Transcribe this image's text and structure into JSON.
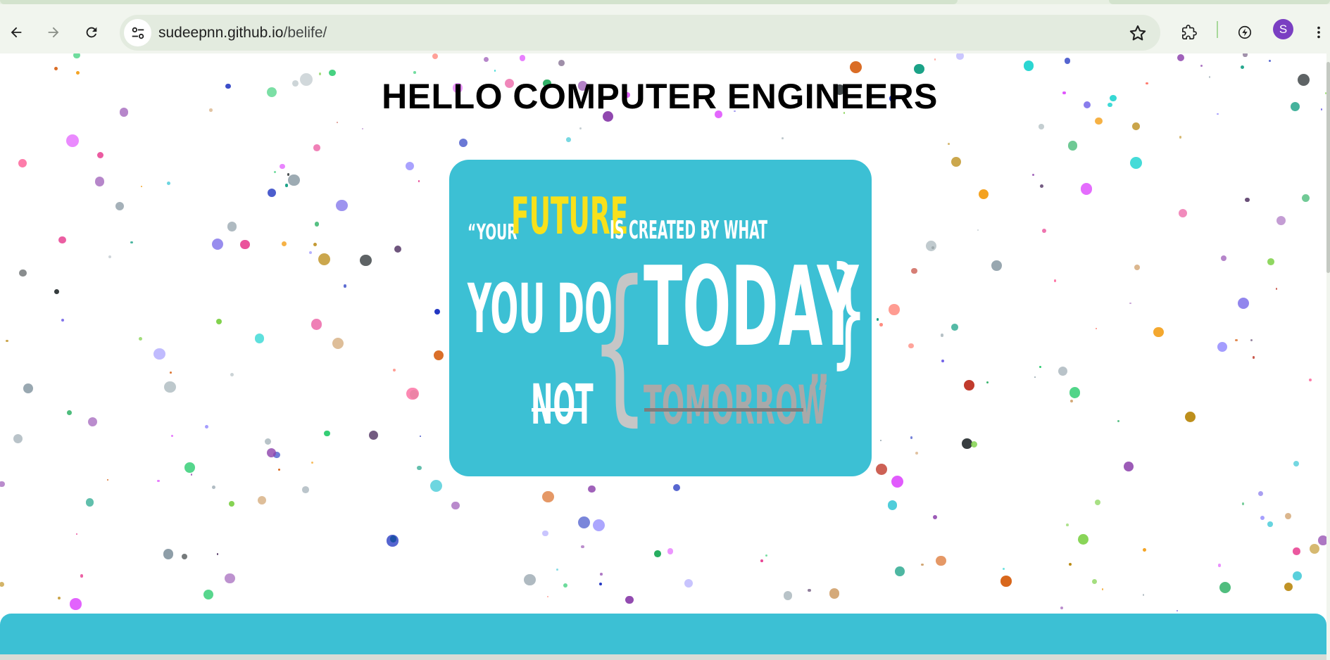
{
  "browser": {
    "back_icon": "arrow-left-icon",
    "forward_icon": "arrow-right-icon",
    "reload_icon": "reload-icon",
    "site_info_icon": "tune-icon",
    "url_host": "sudeepnn.github.io",
    "url_path": "/belife/",
    "bookmark_icon": "star-icon",
    "extensions_icon": "puzzle-icon",
    "performance_icon": "bolt-circle-icon",
    "profile_initial": "S",
    "profile_color": "#7a3fc2",
    "menu_icon": "more-vert-icon"
  },
  "page": {
    "heading": "HELLO COMPUTER ENGINEERS",
    "accent_color": "#3cc0d4",
    "quote": {
      "open": "“YOUR",
      "future": "FUTURE",
      "created": "IS CREATED BY WHAT",
      "you_do": "YOU DO",
      "brace_left": "{",
      "today": "TODAY",
      "brace_right": "}",
      "not": "NOT",
      "tomorrow": "TOMORROW",
      "close": "”",
      "highlight_color": "#f7e11b"
    }
  }
}
